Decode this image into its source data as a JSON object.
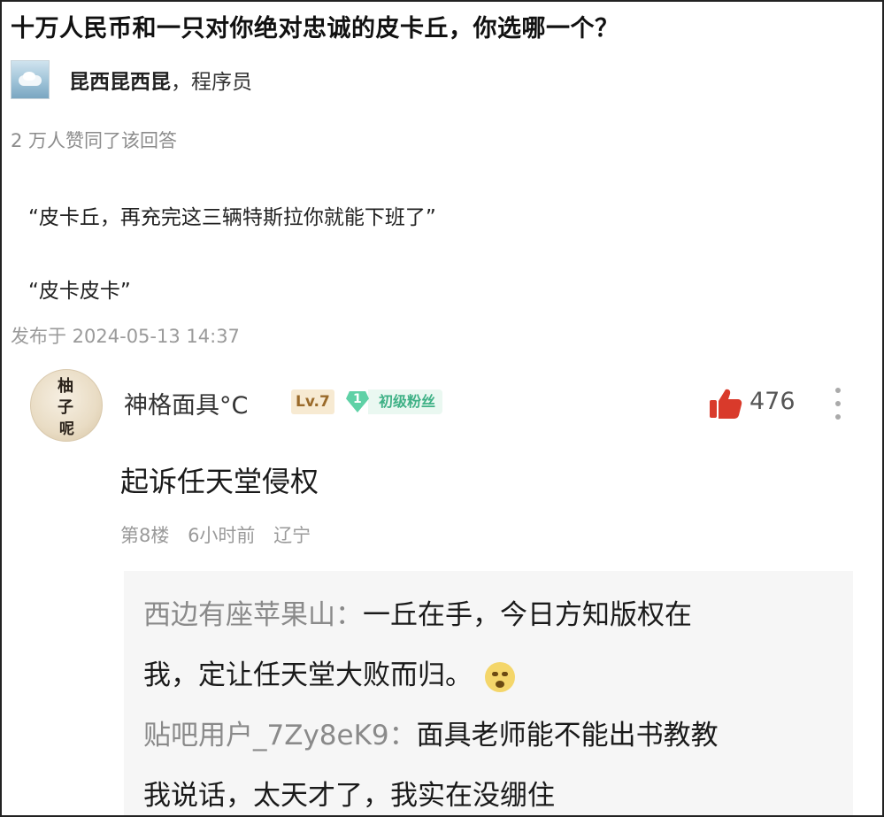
{
  "question": {
    "title": "十万人民币和一只对你绝对忠诚的皮卡丘，你选哪一个？"
  },
  "answer": {
    "author_name": "昆西昆西昆",
    "author_title": "，程序员",
    "likes_text": "2 万人赞同了该回答",
    "paragraphs": [
      "“皮卡丘，再充完这三辆特斯拉你就能下班了”",
      "“皮卡皮卡”"
    ],
    "publish_time": "发布于 2024-05-13 14:37"
  },
  "comment": {
    "user_name": "神格面具°C",
    "level": "Lv.7",
    "fan_level": "1",
    "fan_label": "初级粉丝",
    "like_count": "476",
    "text": "起诉任天堂侵权",
    "floor": "第8楼",
    "time": "6小时前",
    "location": "辽宁",
    "avatar_text": [
      "柚",
      "子",
      "呢"
    ],
    "replies": [
      {
        "user": "西边有座苹果山：",
        "text_line1": "一丘在手，今日方知版权在",
        "text_line2": "我，定让任天堂大败而归。",
        "emoji": "embarrassed-emoji"
      },
      {
        "user": "贴吧用户_7Zy8eK9：",
        "text_line1": "面具老师能不能出书教教",
        "text_line2": "我说话，太天才了，我实在没绷住"
      }
    ]
  },
  "colors": {
    "like_red": "#d93a2b",
    "fan_green": "#3fb186",
    "level_gold": "#9a6a2a"
  }
}
